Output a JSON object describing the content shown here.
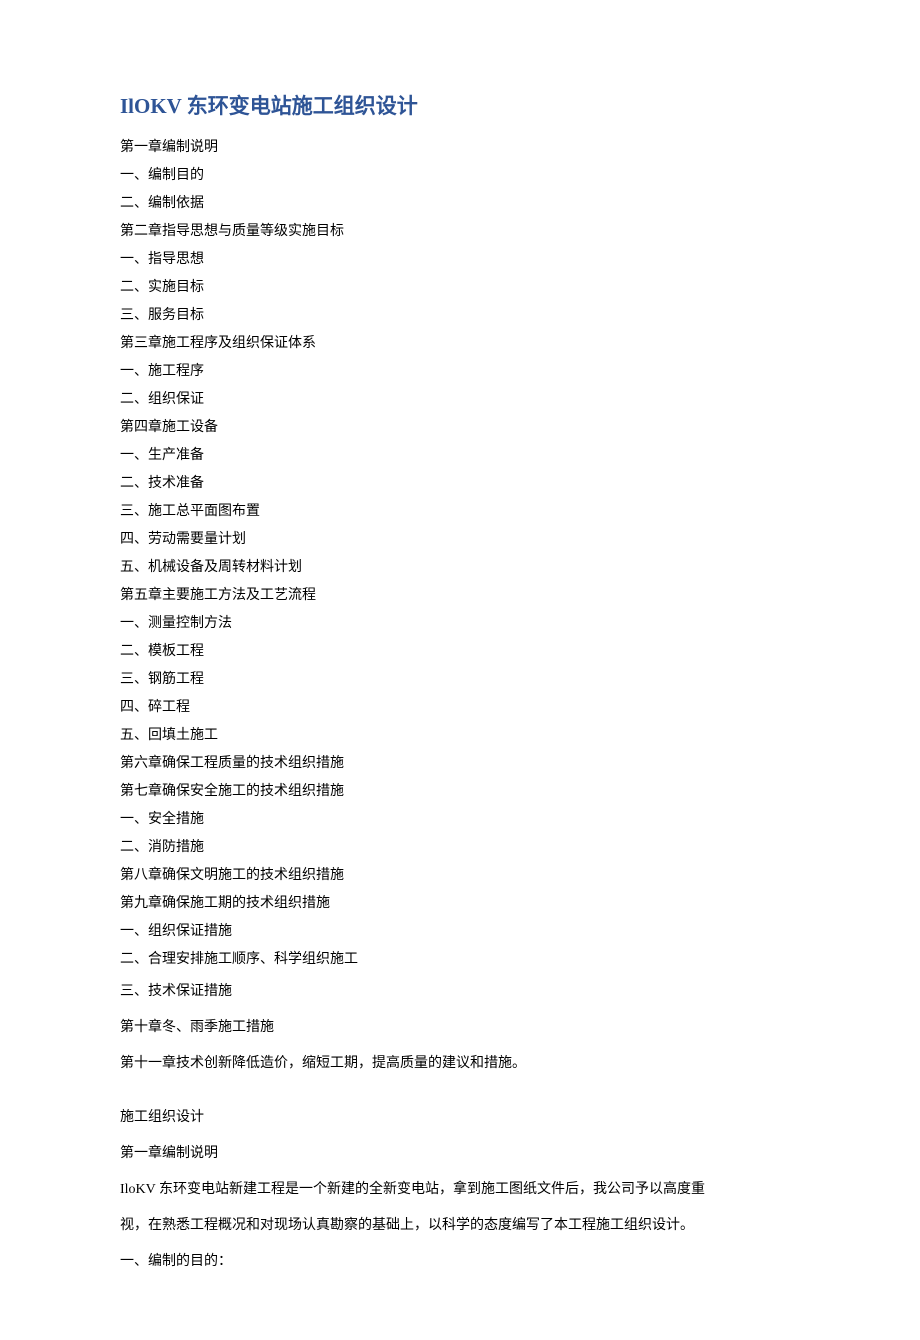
{
  "title": "IlOKV 东环变电站施工组织设计",
  "toc": [
    "第一章编制说明",
    "一、编制目的",
    "二、编制依据",
    "第二章指导思想与质量等级实施目标",
    "一、指导思想",
    "二、实施目标",
    "三、服务目标",
    "第三章施工程序及组织保证体系",
    "一、施工程序",
    "二、组织保证",
    "第四章施工设备",
    "一、生产准备",
    "二、技术准备",
    "三、施工总平面图布置",
    "四、劳动需要量计划",
    "五、机械设备及周转材料计划",
    "第五章主要施工方法及工艺流程",
    "一、测量控制方法",
    "二、模板工程",
    "三、钢筋工程",
    "四、碎工程",
    "五、回填土施工",
    "第六章确保工程质量的技术组织措施",
    "第七章确保安全施工的技术组织措施",
    "一、安全措施",
    "二、消防措施",
    "第八章确保文明施工的技术组织措施",
    "第九章确保施工期的技术组织措施",
    "一、组织保证措施",
    "二、合理安排施工顺序、科学组织施工",
    "三、技术保证措施",
    "第十章冬、雨季施工措施",
    "第十一章技术创新降低造价，缩短工期，提高质量的建议和措施。"
  ],
  "body": [
    "施工组织设计",
    "第一章编制说明",
    "IloKV 东环变电站新建工程是一个新建的全新变电站，拿到施工图纸文件后，我公司予以高度重",
    "视，在熟悉工程概况和对现场认真勘察的基础上，以科学的态度编写了本工程施工组织设计。",
    "一、编制的目的："
  ]
}
